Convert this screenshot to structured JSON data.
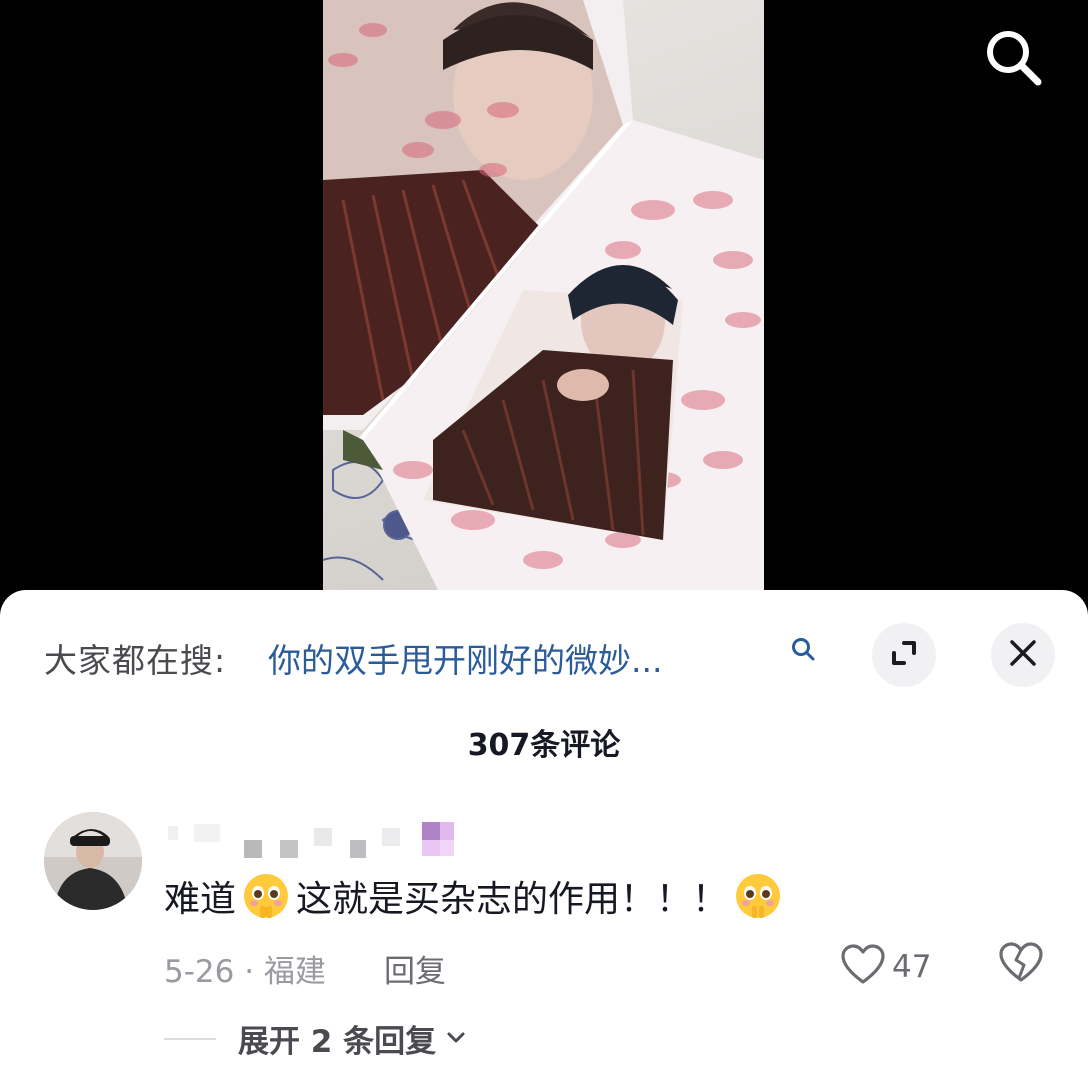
{
  "video": {
    "search_icon": "search-icon",
    "content": "photo of an open magazine with a portrait spread on a floral bed sheet"
  },
  "search_bar": {
    "prefix": "大家都在搜:",
    "query": "你的双手甩开刚好的微妙...",
    "query_icon": "search-icon",
    "expand_icon": "expand-icon",
    "close_icon": "close-icon"
  },
  "comments": {
    "count_label": "307条评论",
    "items": [
      {
        "avatar": "avatar",
        "text_part1": "难道",
        "text_part2": "这就是买杂志的作用！！！",
        "emoji": "pleading-face-emoji",
        "date_location": "5-26 · 福建",
        "reply_label": "回复",
        "likes": "47",
        "expand_label": "展开 2 条回复"
      }
    ]
  },
  "colors": {
    "query_link": "#2a5c9a",
    "primary_text": "#161823",
    "secondary_text": "#9a9aa0",
    "sheet_bg": "#ffffff"
  }
}
